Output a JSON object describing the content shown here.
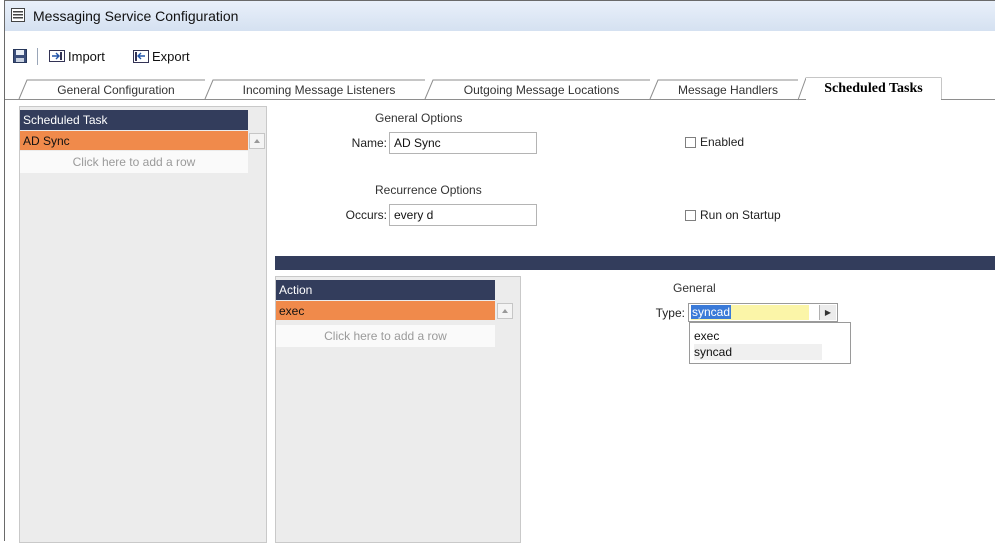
{
  "window": {
    "title": "Messaging Service Configuration"
  },
  "toolbar": {
    "import_label": "Import",
    "export_label": "Export"
  },
  "tabs": [
    {
      "label": "General Configuration",
      "active": false
    },
    {
      "label": "Incoming Message Listeners",
      "active": false
    },
    {
      "label": "Outgoing Message Locations",
      "active": false
    },
    {
      "label": "Message Handlers",
      "active": false
    },
    {
      "label": "Scheduled Tasks",
      "active": true
    }
  ],
  "scheduled_tasks": {
    "header": "Scheduled Task",
    "rows": [
      "AD Sync"
    ],
    "add_row_text": "Click here to add a row"
  },
  "general_options": {
    "title": "General Options",
    "name_label": "Name:",
    "name_value": "AD Sync",
    "enabled_label": "Enabled",
    "enabled_checked": false
  },
  "recurrence_options": {
    "title": "Recurrence Options",
    "occurs_label": "Occurs:",
    "occurs_value": "every d",
    "startup_label": "Run on Startup",
    "startup_checked": false
  },
  "actions": {
    "header": "Action",
    "rows": [
      "exec"
    ],
    "add_row_text": "Click here to add a row"
  },
  "general": {
    "title": "General",
    "type_label": "Type:",
    "type_value": "syncad",
    "type_options": [
      "exec",
      "syncad"
    ]
  },
  "colors": {
    "header_navy": "#333d5c",
    "selected_row": "#f08a4b",
    "highlight_yellow": "#fbf5a8",
    "selection_blue": "#3a7ad8"
  }
}
